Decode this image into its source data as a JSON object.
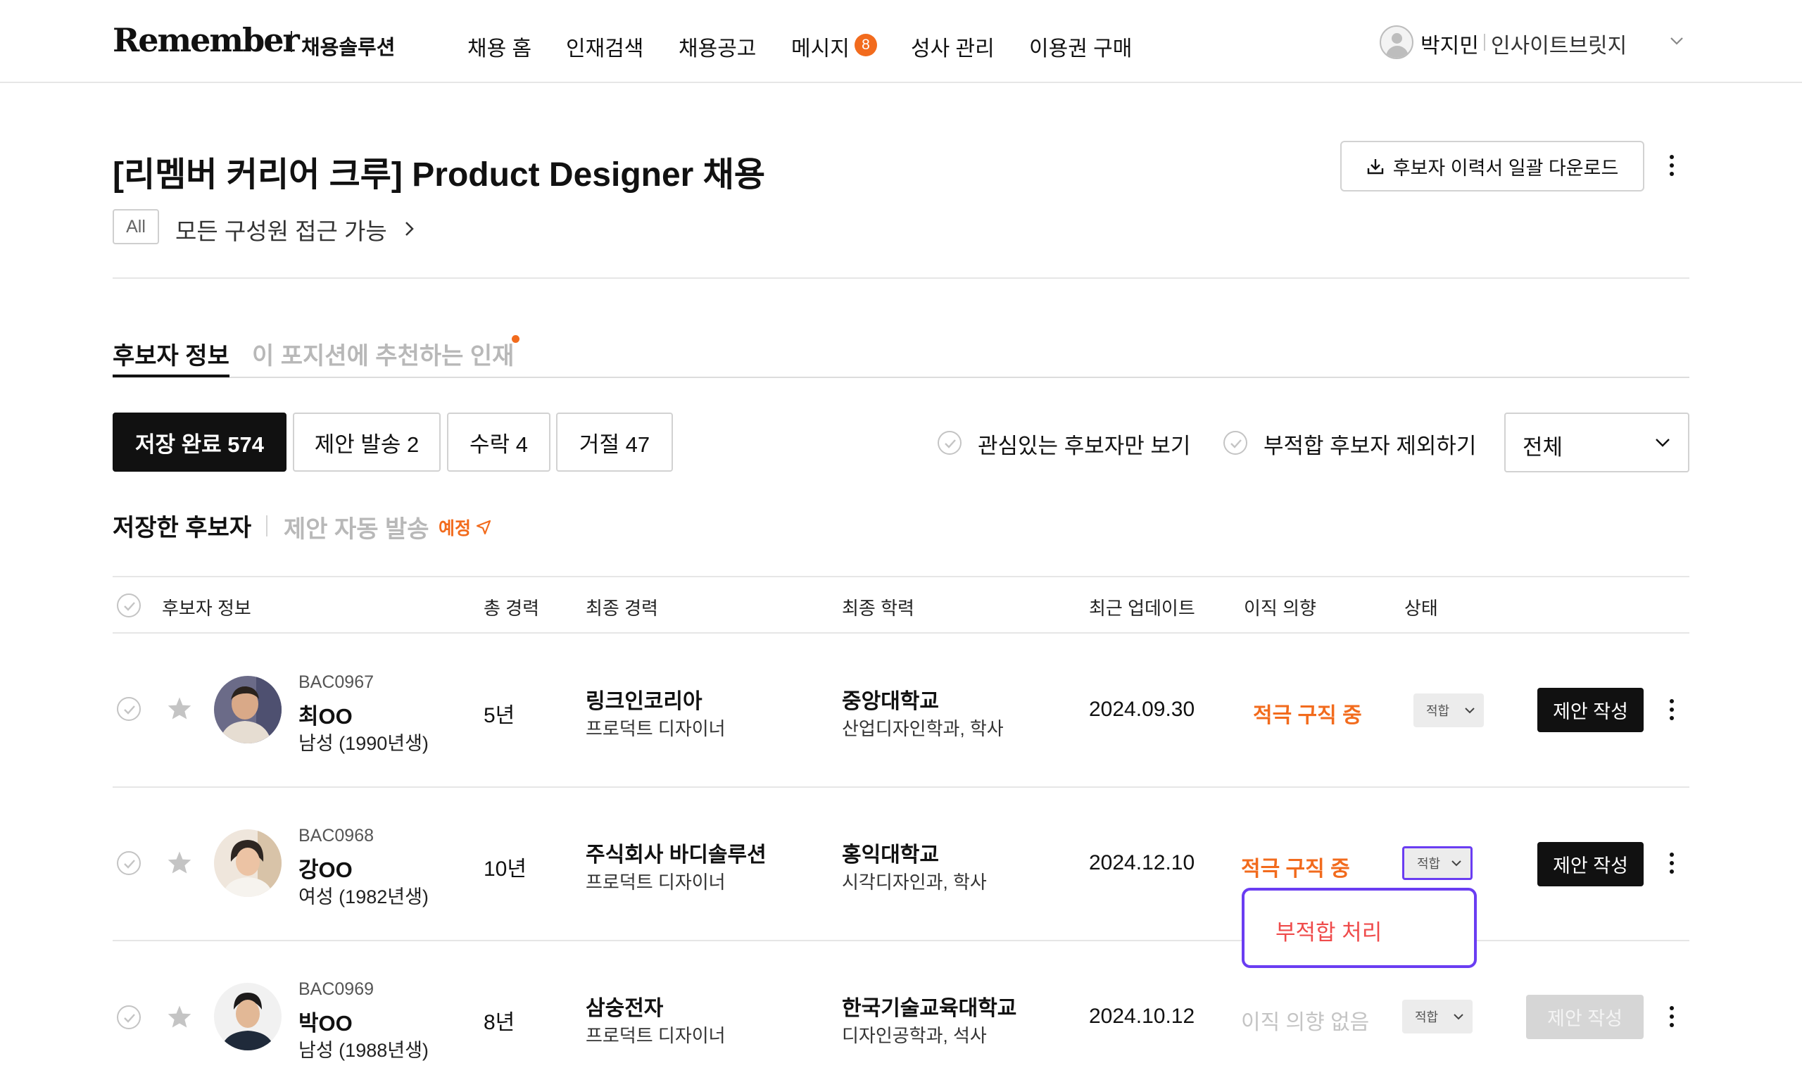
{
  "header": {
    "logo": "Remember",
    "logo_sub": "채용솔루션",
    "nav": [
      "채용 홈",
      "인재검색",
      "채용공고",
      "메시지",
      "성사 관리",
      "이용권 구매"
    ],
    "message_count": "8",
    "user_name": "박지민",
    "company": "인사이트브릿지"
  },
  "page": {
    "title": "[리멤버 커리어 크루] Product Designer 채용",
    "download_label": "후보자 이력서 일괄 다운로드",
    "access_badge": "All",
    "access_text": "모든 구성원 접근 가능"
  },
  "tabs": [
    "후보자 정보",
    "이 포지션에 추천하는 인재"
  ],
  "filters": {
    "buttons": [
      "저장 완료 574",
      "제안 발송 2",
      "수락 4",
      "거절 47"
    ],
    "checks": [
      "관심있는 후보자만 보기",
      "부적합 후보자 제외하기"
    ],
    "select_value": "전체"
  },
  "section": {
    "title": "저장한 후보자",
    "auto_send": "제안 자동 발송",
    "scheduled": "예정"
  },
  "table": {
    "headers": [
      "후보자 정보",
      "총 경력",
      "최종 경력",
      "최종 학력",
      "최근 업데이트",
      "이직 의향",
      "상태"
    ],
    "rows": [
      {
        "id": "BAC0967",
        "name": "최OO",
        "gender": "남성 (1990년생)",
        "experience": "5년",
        "company": "링크인코리아",
        "role": "프로덕트 디자이너",
        "school": "중앙대학교",
        "major": "산업디자인학과, 학사",
        "updated": "2024.09.30",
        "intent": "적극 구직 중",
        "status": "적합",
        "action": "제안 작성"
      },
      {
        "id": "BAC0968",
        "name": "강OO",
        "gender": "여성 (1982년생)",
        "experience": "10년",
        "company": "주식회사 바디솔루션",
        "role": "프로덕트 디자이너",
        "school": "홍익대학교",
        "major": "시각디자인과, 학사",
        "updated": "2024.12.10",
        "intent": "적극 구직 중",
        "status": "적합",
        "action": "제안 작성"
      },
      {
        "id": "BAC0969",
        "name": "박OO",
        "gender": "남성 (1988년생)",
        "experience": "8년",
        "company": "삼숭전자",
        "role": "프로덕트 디자이너",
        "school": "한국기술교육대학교",
        "major": "디자인공학과, 석사",
        "updated": "2024.10.12",
        "intent": "이직 의향 없음",
        "status": "적합",
        "action": "제안 작성"
      }
    ]
  },
  "popup": {
    "item": "부적합 처리"
  },
  "colors": {
    "accent": "#f26b1d",
    "focus": "#6a3df2",
    "danger": "#ef4b4b"
  }
}
